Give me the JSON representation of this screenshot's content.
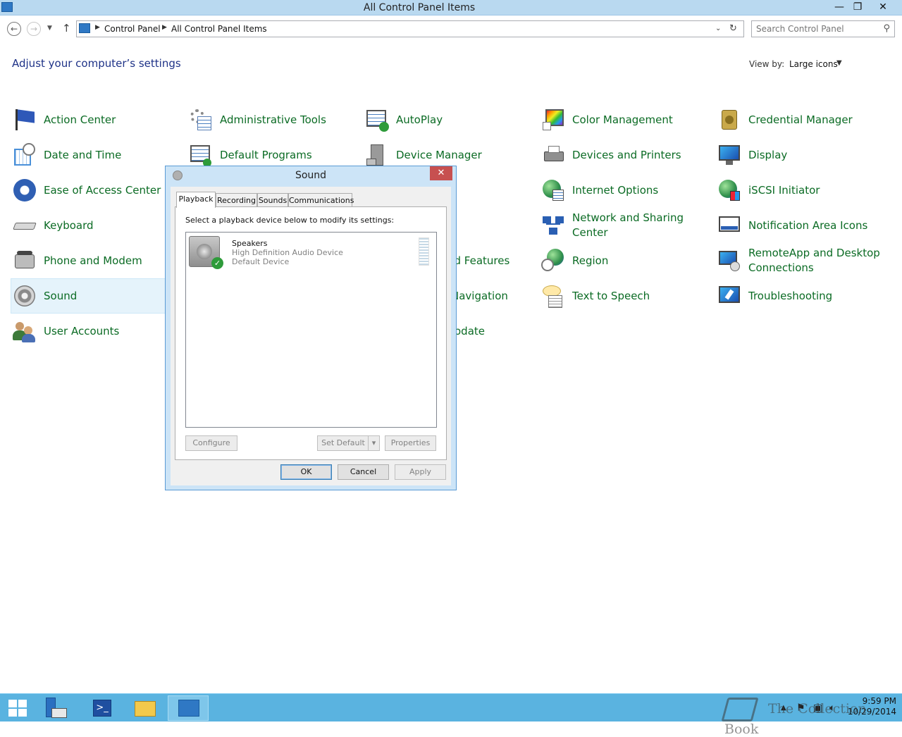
{
  "window": {
    "title": "All Control Panel Items",
    "minimize_glyph": "—",
    "restore_glyph": "❐",
    "close_glyph": "✕"
  },
  "address": {
    "back_icon": "back-arrow-icon",
    "crumbs": [
      "Control Panel",
      "All Control Panel Items"
    ],
    "search_placeholder": "Search Control Panel"
  },
  "main": {
    "heading": "Adjust your computer’s settings",
    "view_by_label": "View by:",
    "view_by_value": "Large icons",
    "items": [
      {
        "label": "Action Center",
        "icon": "flag-icon"
      },
      {
        "label": "Administrative Tools",
        "icon": "admin-tools-icon"
      },
      {
        "label": "AutoPlay",
        "icon": "autoplay-icon"
      },
      {
        "label": "Color Management",
        "icon": "color-management-icon"
      },
      {
        "label": "Credential Manager",
        "icon": "credential-vault-icon"
      },
      {
        "label": "Date and Time",
        "icon": "calendar-clock-icon"
      },
      {
        "label": "Default Programs",
        "icon": "default-programs-icon"
      },
      {
        "label": "Device Manager",
        "icon": "device-manager-icon"
      },
      {
        "label": "Devices and Printers",
        "icon": "printer-icon"
      },
      {
        "label": "Display",
        "icon": "monitor-icon"
      },
      {
        "label": "Ease of Access Center",
        "icon": "ease-of-access-icon"
      },
      {
        "label": "Internet Options",
        "icon": "globe-icon"
      },
      {
        "label": "iSCSI Initiator",
        "icon": "iscsi-globe-icon"
      },
      {
        "label": "Keyboard",
        "icon": "keyboard-icon"
      },
      {
        "label": "Network and Sharing Center",
        "icon": "network-icon"
      },
      {
        "label": "Notification Area Icons",
        "icon": "notification-area-icon"
      },
      {
        "label": "Phone and Modem",
        "icon": "phone-icon"
      },
      {
        "label": "nd Features",
        "icon": ""
      },
      {
        "label": "Region",
        "icon": "region-globe-clock-icon"
      },
      {
        "label": "RemoteApp and Desktop Connections",
        "icon": "remote-desktop-icon"
      },
      {
        "label": "Sound",
        "icon": "speaker-icon"
      },
      {
        "label": "Navigation",
        "icon": ""
      },
      {
        "label": "Text to Speech",
        "icon": "speech-bubble-icon"
      },
      {
        "label": "Troubleshooting",
        "icon": "troubleshooting-icon"
      },
      {
        "label": "User Accounts",
        "icon": "users-icon"
      },
      {
        "label": "odate",
        "icon": ""
      }
    ]
  },
  "dialog": {
    "title": "Sound",
    "close_glyph": "✕",
    "tabs": [
      "Playback",
      "Recording",
      "Sounds",
      "Communications"
    ],
    "active_tab": "Playback",
    "instruction": "Select a playback device below to modify its settings:",
    "device": {
      "name": "Speakers",
      "driver": "High Definition Audio Device",
      "status": "Default Device"
    },
    "buttons": {
      "configure": "Configure",
      "set_default": "Set Default",
      "properties": "Properties",
      "ok": "OK",
      "cancel": "Cancel",
      "apply": "Apply"
    }
  },
  "taskbar": {
    "time": "9:59 PM",
    "date": "10/29/2014",
    "watermark": "The Collection Book"
  }
}
